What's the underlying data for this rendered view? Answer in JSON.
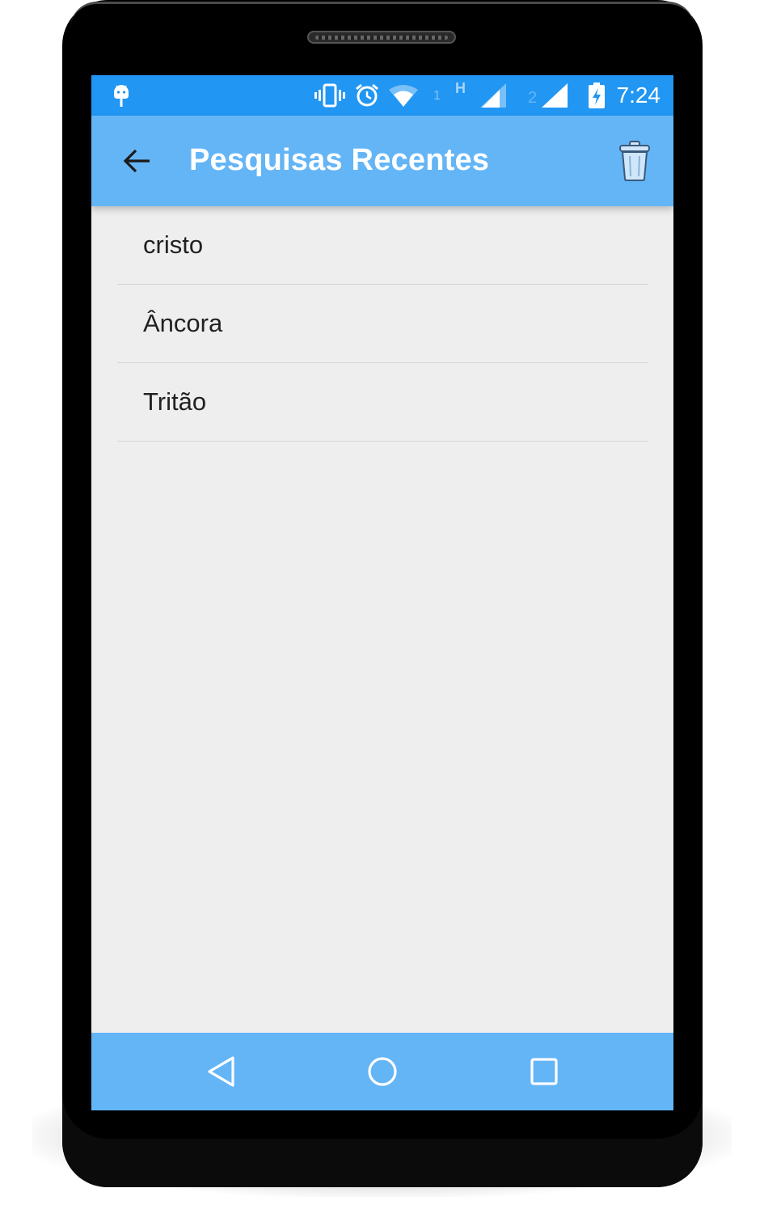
{
  "status_bar": {
    "time": "7:24",
    "sim1_label": "1",
    "sim2_label": "2",
    "network_type": "H",
    "icons": [
      "android-debug-icon",
      "vibrate-icon",
      "alarm-icon",
      "wifi-icon",
      "signal-sim1-icon",
      "signal-sim2-icon",
      "battery-charging-icon"
    ]
  },
  "app_bar": {
    "title": "Pesquisas Recentes",
    "back_icon": "arrow-back-icon",
    "action_icon": "trash-icon"
  },
  "recent_searches": [
    {
      "label": "cristo"
    },
    {
      "label": "Âncora"
    },
    {
      "label": "Tritão"
    }
  ],
  "nav_bar": {
    "buttons": [
      "back-triangle-icon",
      "home-circle-icon",
      "recents-square-icon"
    ]
  },
  "colors": {
    "status_bar": "#2196f3",
    "app_bar": "#64b5f6",
    "background": "#eeeeee",
    "text": "#212121"
  }
}
